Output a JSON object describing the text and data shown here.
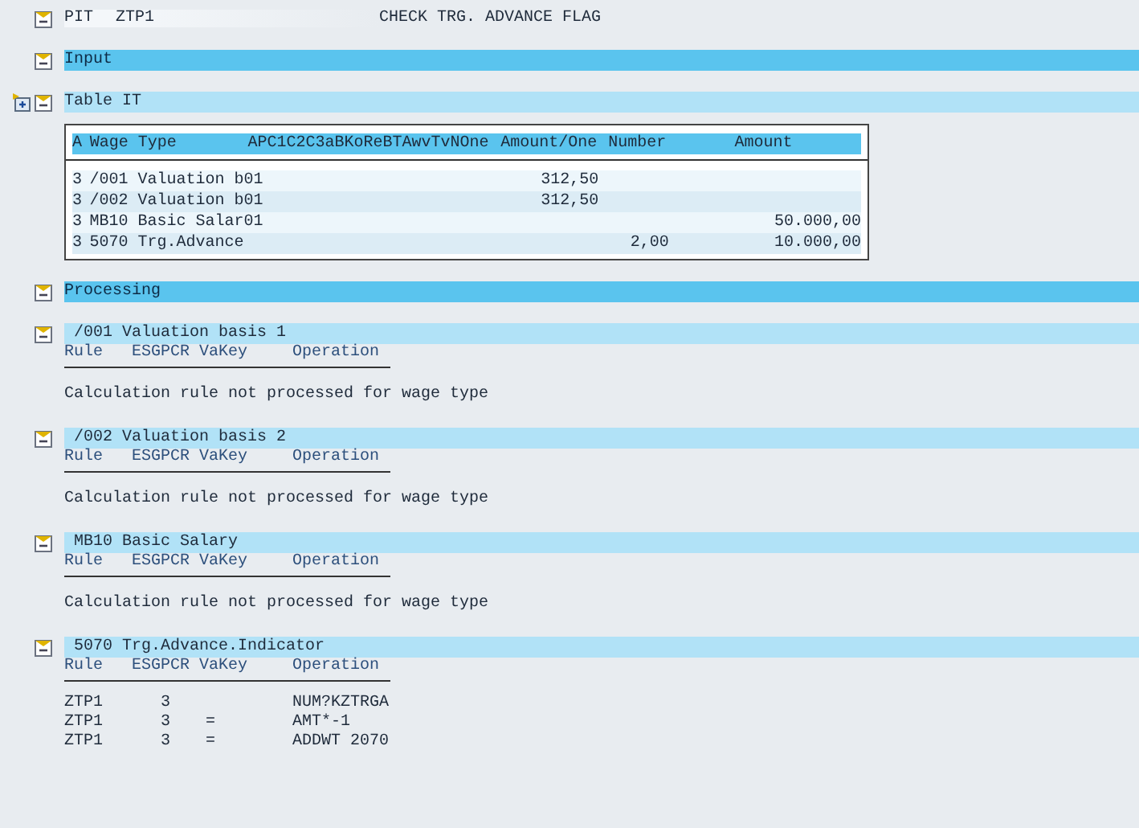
{
  "header": {
    "program": "PIT",
    "rule": "ZTP1",
    "title": "CHECK TRG. ADVANCE FLAG"
  },
  "nodes": [
    {
      "kind": "main",
      "title": "Input"
    },
    {
      "kind": "table",
      "title": "Table IT",
      "table": {
        "columns": [
          "A",
          "Wage Type",
          "APC1C2C3aBKoReBTAwvTvNOne",
          "Amount/One",
          "Number",
          "Amount"
        ],
        "rows": [
          {
            "a": "3",
            "wage_type": "/001 Valuation b01",
            "amount_one": "312,50"
          },
          {
            "a": "3",
            "wage_type": "/002 Valuation b01",
            "amount_one": "312,50"
          },
          {
            "a": "3",
            "wage_type": "MB10 Basic Salar01",
            "amount": "50.000,00"
          },
          {
            "a": "3",
            "wage_type": "5070 Trg.Advance",
            "number": "2,00",
            "amount": "10.000,00"
          }
        ]
      }
    },
    {
      "kind": "main",
      "title": "Processing"
    },
    {
      "kind": "sub",
      "title": "/001 Valuation basis 1",
      "columns": [
        "Rule",
        "ESGPCR",
        "VaKey",
        "Operation"
      ],
      "message": "Calculation rule not processed for wage type"
    },
    {
      "kind": "sub",
      "title": "/002 Valuation basis 2",
      "columns": [
        "Rule",
        "ESGPCR",
        "VaKey",
        "Operation"
      ],
      "message": "Calculation rule not processed for wage type"
    },
    {
      "kind": "sub",
      "title": "MB10 Basic Salary",
      "columns": [
        "Rule",
        "ESGPCR",
        "VaKey",
        "Operation"
      ],
      "message": "Calculation rule not processed for wage type"
    },
    {
      "kind": "sub",
      "title": "5070 Trg.Advance.Indicator",
      "columns": [
        "Rule",
        "ESGPCR",
        "VaKey",
        "Operation"
      ],
      "rules": [
        {
          "rule": "ZTP1",
          "esgpcr": "3",
          "operation": "NUM?KZTRGA"
        },
        {
          "rule": "ZTP1",
          "esgpcr": "3",
          "vakey": "=",
          "operation": "AMT*-1"
        },
        {
          "rule": "ZTP1",
          "esgpcr": "3",
          "vakey": "=",
          "operation": "ADDWT 2070"
        }
      ]
    }
  ]
}
